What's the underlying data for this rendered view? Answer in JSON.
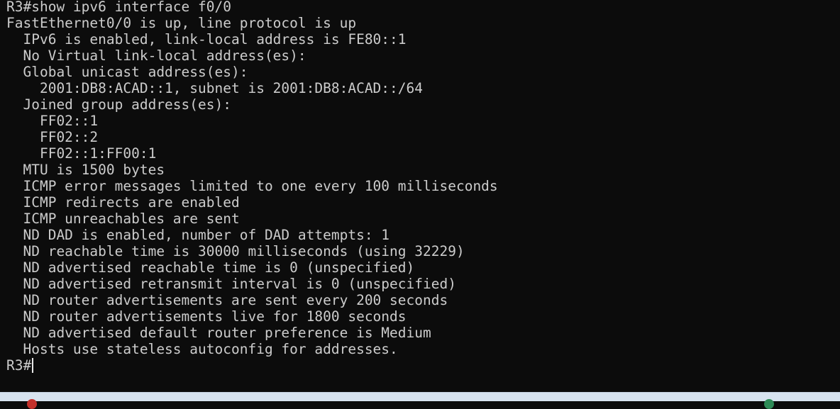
{
  "terminal": {
    "lines": [
      "R3#show ipv6 interface f0/0",
      "FastEthernet0/0 is up, line protocol is up",
      "  IPv6 is enabled, link-local address is FE80::1",
      "  No Virtual link-local address(es):",
      "  Global unicast address(es):",
      "    2001:DB8:ACAD::1, subnet is 2001:DB8:ACAD::/64",
      "  Joined group address(es):",
      "    FF02::1",
      "    FF02::2",
      "    FF02::1:FF00:1",
      "  MTU is 1500 bytes",
      "  ICMP error messages limited to one every 100 milliseconds",
      "  ICMP redirects are enabled",
      "  ICMP unreachables are sent",
      "  ND DAD is enabled, number of DAD attempts: 1",
      "  ND reachable time is 30000 milliseconds (using 32229)",
      "  ND advertised reachable time is 0 (unspecified)",
      "  ND advertised retransmit interval is 0 (unspecified)",
      "  ND router advertisements are sent every 200 seconds",
      "  ND router advertisements live for 1800 seconds",
      "  ND advertised default router preference is Medium",
      "  Hosts use stateless autoconfig for addresses."
    ],
    "prompt": "R3#"
  },
  "colors": {
    "background": "#0c0c0c",
    "foreground": "#cccccc",
    "taskbar": "#d7e3ef"
  },
  "taskbar": {
    "icons": [
      "app-icon-red",
      "app-icon-green"
    ]
  }
}
